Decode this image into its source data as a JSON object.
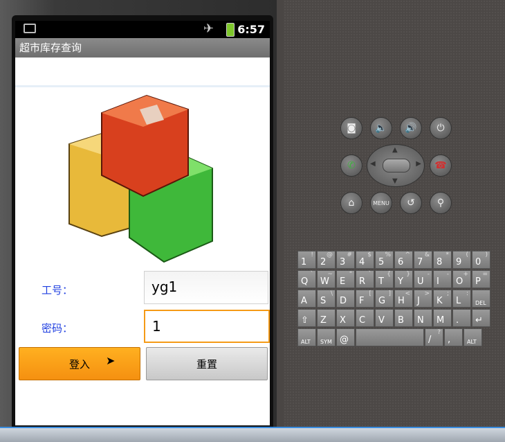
{
  "status_bar": {
    "time": "6:57"
  },
  "app": {
    "title": "超市库存查询"
  },
  "form": {
    "employee_label": "工号：",
    "employee_value": "yg1",
    "password_label": "密码：",
    "password_value": "1",
    "login_label": "登入",
    "reset_label": "重置"
  },
  "controls": {
    "menu_label": "MENU"
  },
  "keyboard": {
    "rows": [
      [
        [
          "1",
          "!"
        ],
        [
          "2",
          "@"
        ],
        [
          "3",
          "#"
        ],
        [
          "4",
          "$"
        ],
        [
          "5",
          "%"
        ],
        [
          "6",
          "^"
        ],
        [
          "7",
          "&"
        ],
        [
          "8",
          "*"
        ],
        [
          "9",
          "("
        ],
        [
          "0",
          ")"
        ]
      ],
      [
        [
          "Q",
          "`"
        ],
        [
          "W",
          "~"
        ],
        [
          "E",
          "\""
        ],
        [
          "R",
          "`"
        ],
        [
          "T",
          "{"
        ],
        [
          "Y",
          "}"
        ],
        [
          "U",
          "-"
        ],
        [
          "I",
          "-"
        ],
        [
          "O",
          "+"
        ],
        [
          "P",
          "="
        ]
      ],
      [
        [
          "A",
          ""
        ],
        [
          "S",
          "\\"
        ],
        [
          "D",
          ""
        ],
        [
          "F",
          "["
        ],
        [
          "G",
          "]"
        ],
        [
          "H",
          "<"
        ],
        [
          "J",
          ">"
        ],
        [
          "K",
          ";"
        ],
        [
          "L",
          ":"
        ],
        [
          "DEL",
          ""
        ]
      ],
      [
        [
          "⇧",
          ""
        ],
        [
          "Z",
          ""
        ],
        [
          "X",
          ""
        ],
        [
          "C",
          ""
        ],
        [
          "V",
          ""
        ],
        [
          "B",
          ""
        ],
        [
          "N",
          ""
        ],
        [
          "M",
          ""
        ],
        [
          ".",
          ""
        ],
        [
          "↵",
          ""
        ]
      ],
      [
        [
          "ALT",
          ""
        ],
        [
          "SYM",
          ""
        ],
        [
          "@",
          ""
        ],
        [
          "",
          ""
        ],
        [
          "/",
          "?"
        ],
        [
          ",",
          ""
        ],
        [
          "ALT",
          ""
        ]
      ]
    ]
  }
}
